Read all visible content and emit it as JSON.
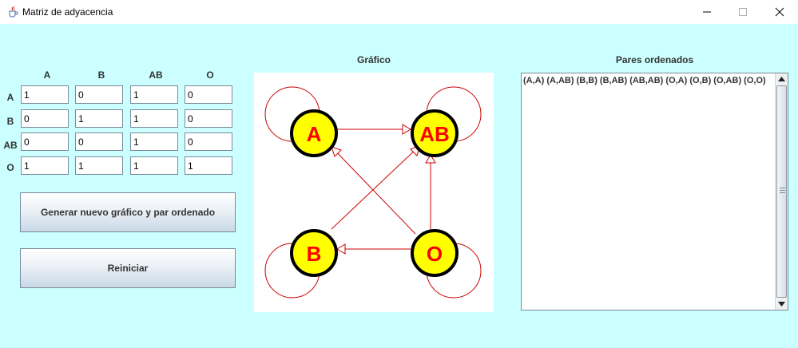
{
  "window": {
    "title": "Matriz de adyacencia",
    "icon": "java-cup-icon"
  },
  "matrix": {
    "col_headers": [
      "A",
      "B",
      "AB",
      "O"
    ],
    "row_headers": [
      "A",
      "B",
      "AB",
      "O"
    ],
    "rows": [
      [
        "1",
        "0",
        "1",
        "0"
      ],
      [
        "0",
        "1",
        "1",
        "0"
      ],
      [
        "0",
        "0",
        "1",
        "0"
      ],
      [
        "1",
        "1",
        "1",
        "1"
      ]
    ]
  },
  "buttons": {
    "generate_label": "Generar nuevo gráfico y par ordenado",
    "reset_label": "Reiniciar"
  },
  "graph": {
    "title": "Gráfico",
    "nodes": [
      "A",
      "AB",
      "B",
      "O"
    ],
    "node_fill": "#ffff00",
    "node_stroke": "#000000",
    "label_color": "#ff0000",
    "edge_color": "#cc0000"
  },
  "pairs": {
    "title": "Pares ordenados",
    "text": "(A,A) (A,AB) (B,B) (B,AB) (AB,AB) (O,A) (O,B) (O,AB) (O,O)"
  },
  "colors": {
    "background": "#ccffff"
  }
}
